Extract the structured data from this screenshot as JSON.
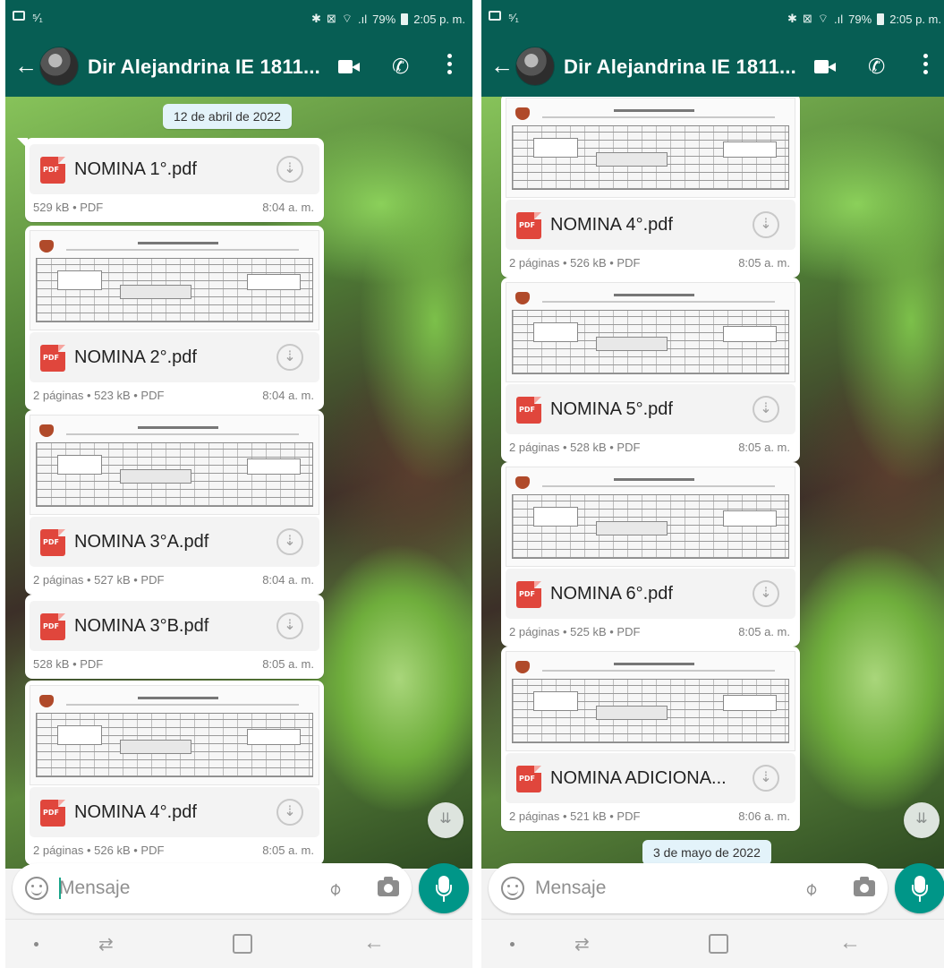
{
  "colors": {
    "header": "#075e54",
    "accent": "#009688",
    "pdf_red": "#e0463c",
    "date_chip": "#e3f3fa"
  },
  "screens": [
    {
      "status": {
        "left": "▣ ⁵⁄₁",
        "right": "✱ ⊠ ⌔ .ıl 79% ▮ 2:05 p. m."
      },
      "header": {
        "title": "Dir Alejandrina IE 1811..."
      },
      "date_chip": "12 de abril de 2022",
      "messages": [
        {
          "file": "NOMINA 1°.pdf",
          "meta": "529 kB • PDF",
          "time": "8:04 a. m."
        },
        {
          "file": "NOMINA 2°.pdf",
          "meta": "2 páginas • 523 kB • PDF",
          "time": "8:04 a. m."
        },
        {
          "file": "NOMINA 3°A.pdf",
          "meta": "2 páginas • 527 kB • PDF",
          "time": "8:04 a. m."
        },
        {
          "file": "NOMINA 3°B.pdf",
          "meta": "528 kB • PDF",
          "time": "8:05 a. m."
        },
        {
          "file": "NOMINA 4°.pdf",
          "meta": "2 páginas • 526 kB • PDF",
          "time": "8:05 a. m."
        }
      ],
      "composer": {
        "placeholder": "Mensaje"
      }
    },
    {
      "status": {
        "left": "▣ ⁵⁄₁",
        "right": "✱ ⊠ ⌔ .ıl 79% ▮ 2:05 p. m."
      },
      "header": {
        "title": "Dir Alejandrina IE 1811..."
      },
      "date_chip": "3 de mayo de 2022",
      "messages": [
        {
          "file": "NOMINA 4°.pdf",
          "meta": "2 páginas • 526 kB • PDF",
          "time": "8:05 a. m."
        },
        {
          "file": "NOMINA 5°.pdf",
          "meta": "2 páginas • 528 kB • PDF",
          "time": "8:05 a. m."
        },
        {
          "file": "NOMINA 6°.pdf",
          "meta": "2 páginas • 525 kB • PDF",
          "time": "8:05 a. m."
        },
        {
          "file": "NOMINA ADICIONA...",
          "meta": "2 páginas • 521 kB • PDF",
          "time": "8:06 a. m."
        }
      ],
      "composer": {
        "placeholder": "Mensaje"
      }
    }
  ]
}
